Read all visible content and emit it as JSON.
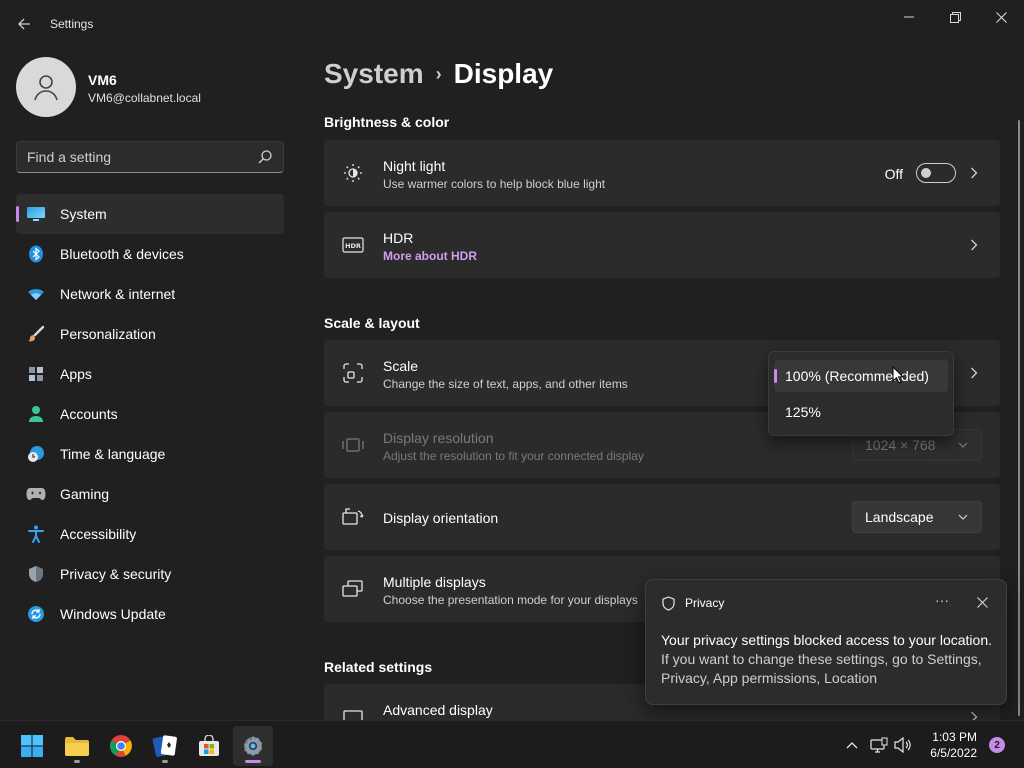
{
  "window": {
    "title": "Settings"
  },
  "profile": {
    "name": "VM6",
    "email": "VM6@collabnet.local"
  },
  "search": {
    "placeholder": "Find a setting"
  },
  "nav": {
    "items": [
      {
        "label": "System",
        "icon": "monitor-icon",
        "selected": true
      },
      {
        "label": "Bluetooth & devices",
        "icon": "bluetooth-icon"
      },
      {
        "label": "Network & internet",
        "icon": "wifi-icon"
      },
      {
        "label": "Personalization",
        "icon": "brush-icon"
      },
      {
        "label": "Apps",
        "icon": "apps-icon"
      },
      {
        "label": "Accounts",
        "icon": "person-icon"
      },
      {
        "label": "Time & language",
        "icon": "clock-globe-icon"
      },
      {
        "label": "Gaming",
        "icon": "gamepad-icon"
      },
      {
        "label": "Accessibility",
        "icon": "accessibility-icon"
      },
      {
        "label": "Privacy & security",
        "icon": "shield-icon"
      },
      {
        "label": "Windows Update",
        "icon": "update-icon"
      }
    ]
  },
  "breadcrumb": {
    "parent": "System",
    "separator": "›",
    "current": "Display"
  },
  "sections": {
    "brightness": "Brightness & color",
    "scale_layout": "Scale & layout",
    "related": "Related settings"
  },
  "night_light": {
    "title": "Night light",
    "subtitle": "Use warmer colors to help block blue light",
    "state": "Off"
  },
  "hdr": {
    "title": "HDR",
    "link": "More about HDR"
  },
  "scale": {
    "title": "Scale",
    "subtitle": "Change the size of text, apps, and other items",
    "options": [
      "100% (Recommended)",
      "125%"
    ],
    "selected": "100% (Recommended)"
  },
  "resolution": {
    "title": "Display resolution",
    "subtitle": "Adjust the resolution to fit your connected display",
    "value": "1024 × 768"
  },
  "orientation": {
    "title": "Display orientation",
    "value": "Landscape"
  },
  "multiple_displays": {
    "title": "Multiple displays",
    "subtitle": "Choose the presentation mode for your displays"
  },
  "advanced_display": {
    "title": "Advanced display"
  },
  "toast": {
    "title": "Privacy",
    "body_line1": "Your privacy settings blocked access to your location.",
    "body_line2": "If you want to change these settings, go to Settings, Privacy, App permissions, Location",
    "more": "···"
  },
  "taskbar": {
    "time": "1:03 PM",
    "date": "6/5/2022",
    "notification_count": "2",
    "apps": [
      "start-icon",
      "file-explorer-icon",
      "chrome-icon",
      "solitaire-icon",
      "store-icon",
      "settings-icon"
    ]
  },
  "colors": {
    "accent": "#c68be8",
    "background": "#202020",
    "card": "#2b2b2b",
    "link": "#d49ef0"
  }
}
